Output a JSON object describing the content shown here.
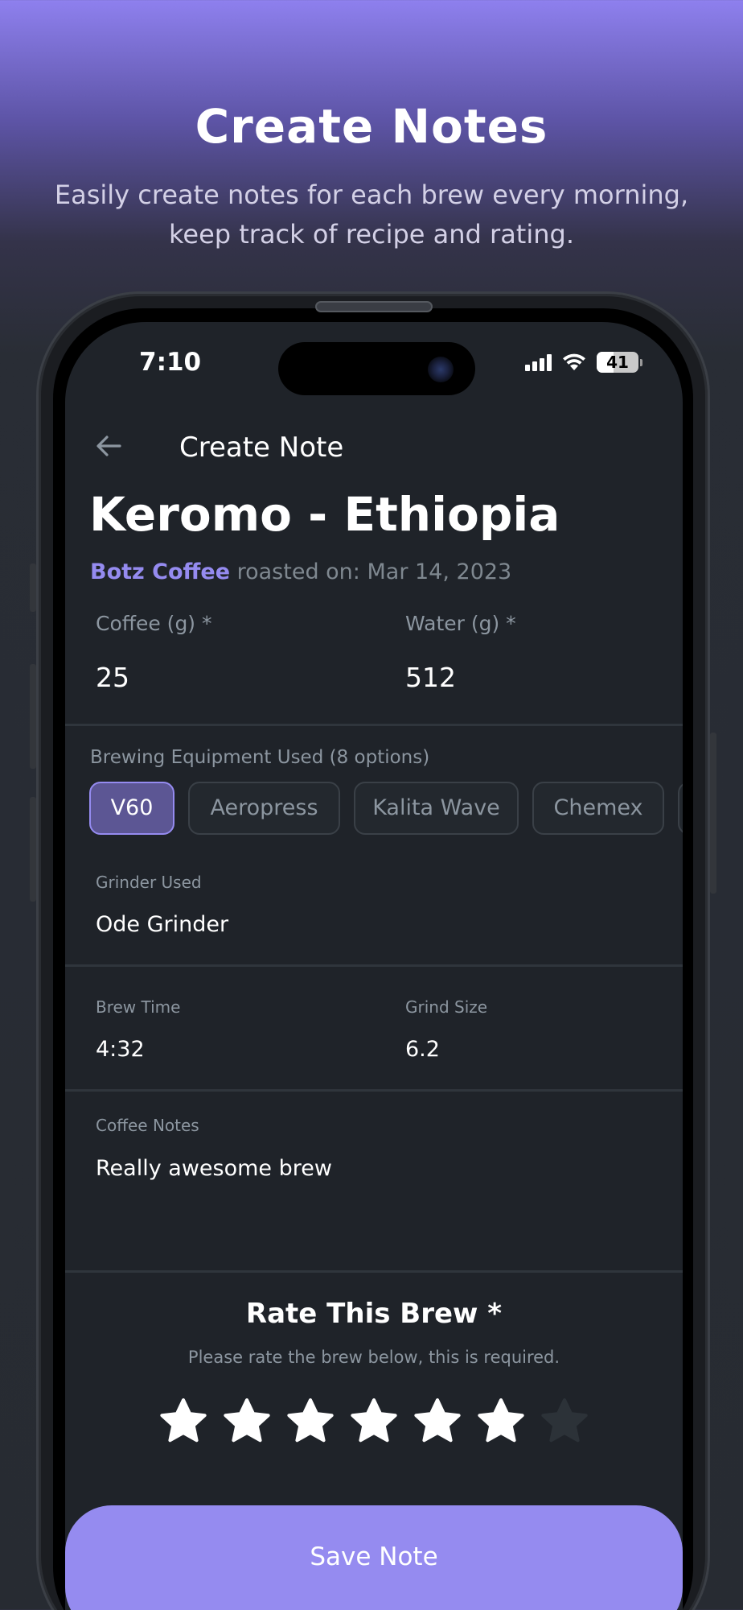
{
  "hero": {
    "title": "Create Notes",
    "subtitle": "Easily create notes for each brew every morning, keep track of recipe and rating."
  },
  "status_bar": {
    "time": "7:10",
    "battery": "41"
  },
  "nav": {
    "title": "Create Note",
    "back_icon": "arrow-left-icon"
  },
  "bean": {
    "name": "Keromo - Ethiopia",
    "roaster": "Botz Coffee",
    "roasted_on": "roasted on: Mar 14, 2023"
  },
  "recipe": {
    "coffee_label": "Coffee (g) *",
    "coffee_value": "25",
    "water_label": "Water (g) *",
    "water_value": "512"
  },
  "equipment": {
    "label": "Brewing Equipment Used (8 options)",
    "options": [
      "V60",
      "Aeropress",
      "Kalita Wave",
      "Chemex"
    ],
    "selected": "V60"
  },
  "grinder": {
    "label": "Grinder Used",
    "value": "Ode Grinder"
  },
  "brew_time": {
    "label": "Brew Time",
    "value": "4:32"
  },
  "grind_size": {
    "label": "Grind Size",
    "value": "6.2"
  },
  "notes": {
    "label": "Coffee Notes",
    "value": "Really awesome brew"
  },
  "rating": {
    "title": "Rate This Brew *",
    "subtitle": "Please rate the brew below, this is required.",
    "value": 6,
    "max": 7
  },
  "save_label": "Save Note",
  "colors": {
    "accent": "#958bf0",
    "background": "#1f2329",
    "muted_text": "#8c96a0",
    "star_filled": "#ffffff",
    "star_empty": "#2c3238"
  }
}
